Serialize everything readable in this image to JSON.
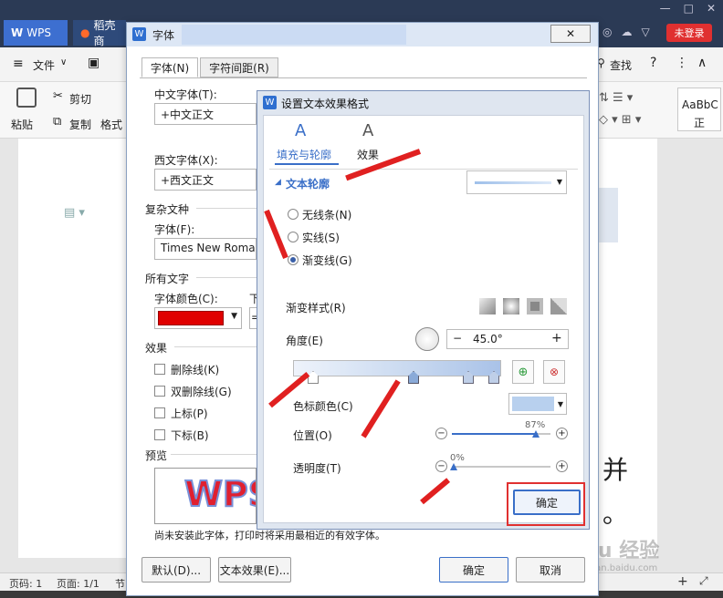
{
  "app": {
    "tab_wps": "WPS",
    "tab_doc": "稻壳商",
    "login": "未登录"
  },
  "menu": {
    "file": "文件",
    "search": "查找"
  },
  "ribbon": {
    "paste": "粘贴",
    "cut": "剪切",
    "copy": "复制",
    "format": "格式",
    "style": "AaBbC",
    "style2": "正"
  },
  "status": {
    "page": "页码: 1",
    "pages": "页面: 1/1",
    "section": "节"
  },
  "doc_text": {
    "right_char": "并",
    "dot": "。"
  },
  "font_dialog": {
    "title": "字体",
    "tabs": [
      "字体(N)",
      "字符间距(R)"
    ],
    "cn_font_label": "中文字体(T):",
    "cn_font_value": "+中文正文",
    "west_font_label": "西文字体(X):",
    "west_font_value": "+西文正文",
    "complex_label": "复杂文种",
    "complex_font_label": "字体(F):",
    "complex_font_value": "Times New Roman",
    "all_text_label": "所有文字",
    "font_color_label": "字体颜色(C):",
    "underline_short": "下",
    "underline_eq": "=",
    "effects_label": "效果",
    "effects": [
      "删除线(K)",
      "双删除线(G)",
      "上标(P)",
      "下标(B)"
    ],
    "preview_label": "预览",
    "preview_text": "WPS",
    "notice": "尚未安装此字体，打印时将采用最相近的有效字体。",
    "btn_default": "默认(D)...",
    "btn_text_effect": "文本效果(E)...",
    "btn_ok": "确定",
    "btn_cancel": "取消",
    "font_color": "#e00000"
  },
  "fx_dialog": {
    "title": "设置文本效果格式",
    "tab_fill": "填充与轮廓",
    "tab_effect": "效果",
    "section": "文本轮廓",
    "radios": [
      {
        "label": "无线条(N)",
        "on": false
      },
      {
        "label": "实线(S)",
        "on": false
      },
      {
        "label": "渐变线(G)",
        "on": true
      }
    ],
    "gradient_style_label": "渐变样式(R)",
    "angle_label": "角度(E)",
    "angle_value": "45.0°",
    "stop_color_label": "色标颜色(C)",
    "position_label": "位置(O)",
    "position_value": "87%",
    "position_fraction": 0.87,
    "opacity_label": "透明度(T)",
    "opacity_value": "0%",
    "opacity_fraction": 0,
    "ok": "确定",
    "stop_color": "#b8d0ee",
    "accent": "#3a6fc8"
  },
  "watermark": "Baidu 经验",
  "watermark_sub": "jingyan.baidu.com"
}
